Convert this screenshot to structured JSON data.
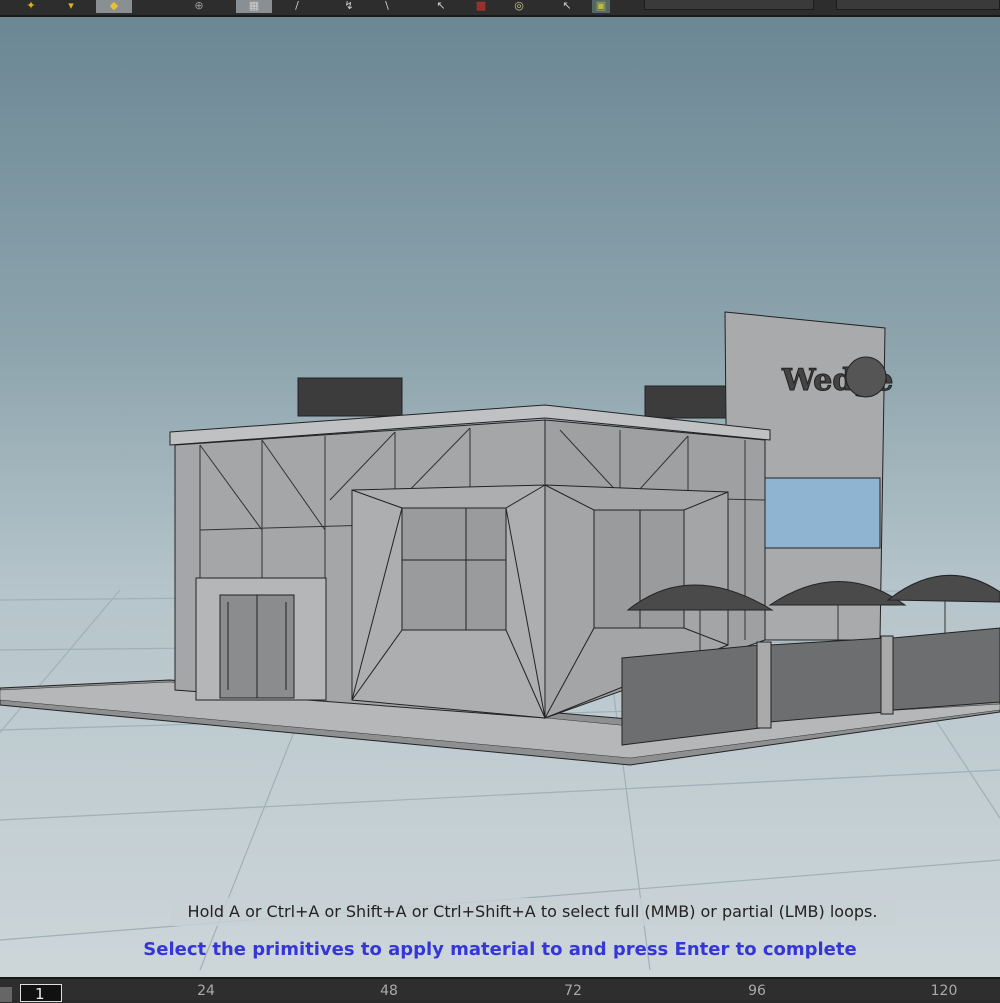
{
  "toolbar": {
    "icons": [
      "select-icon",
      "pose-icon",
      "handle-icon",
      "snap-icon",
      "grid-icon",
      "brush-icon",
      "pen-icon",
      "knife-icon",
      "arrow-icon",
      "material-icon",
      "render-icon",
      "arrow-icon",
      "display-icon"
    ]
  },
  "viewport": {
    "hint": "Hold A or Ctrl+A or Shift+A or Ctrl+Shift+A to select full (MMB) or partial (LMB) loops.",
    "prompt": "Select the primitives to apply material to and press Enter to complete",
    "prompt_color": "#3535d8"
  },
  "timeline": {
    "current_frame": "1",
    "ticks": [
      "24",
      "48",
      "72",
      "96",
      "120"
    ]
  }
}
